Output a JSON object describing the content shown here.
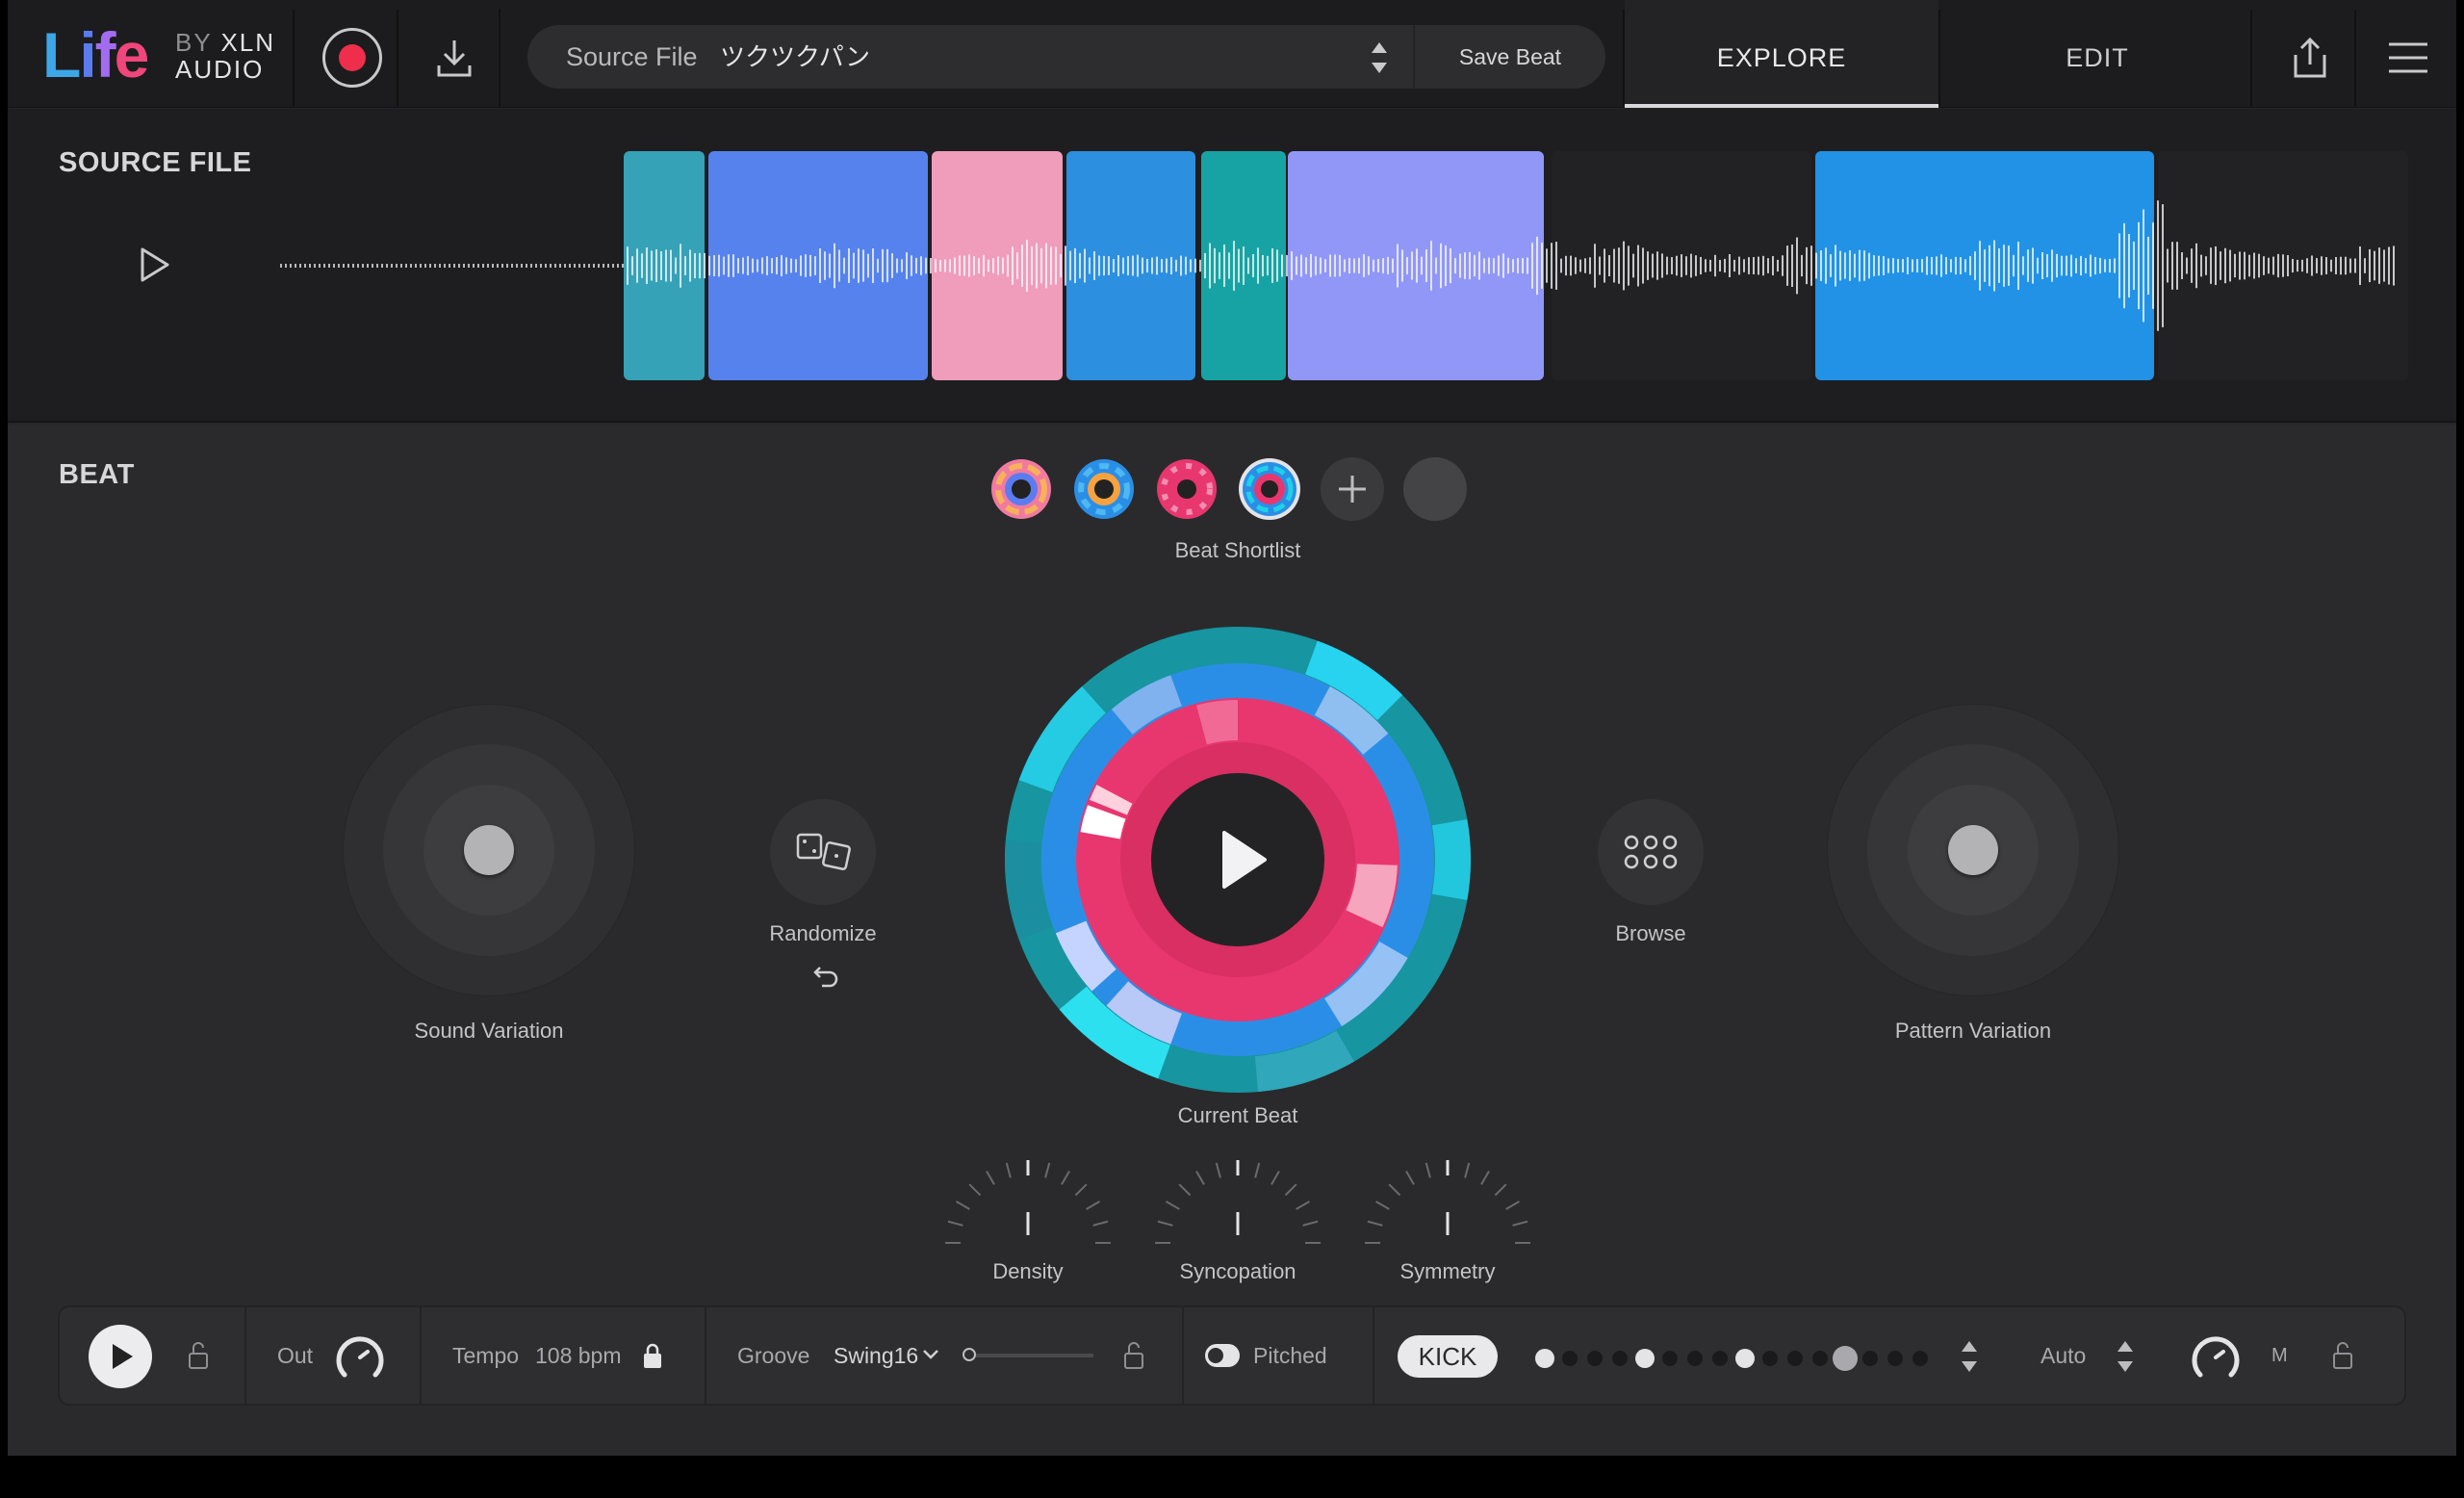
{
  "app": {
    "brand": {
      "life": [
        "L",
        "i",
        "f",
        "e"
      ],
      "by": "BY",
      "xln": "XLN",
      "audio": "AUDIO"
    }
  },
  "topbar": {
    "source_label": "Source File",
    "source_name": "ツクツクパン",
    "save_beat": "Save Beat",
    "tabs": [
      {
        "label": "EXPLORE",
        "active": true
      },
      {
        "label": "EDIT",
        "active": false
      }
    ]
  },
  "source_section": {
    "title": "SOURCE FILE",
    "segment_colors": [
      "#35a2b8",
      "#5682ee",
      "#f09cbb",
      "#2c8fe0",
      "#17a3a3",
      "#9197f7",
      "#222224",
      "#2192e6",
      "#222224"
    ]
  },
  "beat": {
    "title": "BEAT",
    "shortlist_label": "Beat Shortlist",
    "current_beat_label": "Current Beat",
    "sound_variation_label": "Sound Variation",
    "pattern_variation_label": "Pattern Variation",
    "randomize_label": "Randomize",
    "browse_label": "Browse",
    "dials": [
      {
        "label": "Density"
      },
      {
        "label": "Syncopation"
      },
      {
        "label": "Symmetry"
      }
    ]
  },
  "bottombar": {
    "out_label": "Out",
    "tempo_label": "Tempo",
    "tempo_value": "108 bpm",
    "groove_label": "Groove",
    "groove_value": "Swing16",
    "groove_amount": 0.0,
    "pitched_label": "Pitched",
    "pitched_on": true,
    "kick_label": "KICK",
    "auto_label": "Auto",
    "m_label": "M",
    "steps": [
      "on",
      "off",
      "off",
      "off",
      "on",
      "off",
      "off",
      "off",
      "on",
      "off",
      "off",
      "off",
      "big",
      "off",
      "off",
      "off"
    ]
  },
  "colors": {
    "accent_red": "#ee2e4b",
    "pink": "#e8366f",
    "blue": "#2b8ee6",
    "cyan": "#1fd0e6",
    "teal": "#1795a0"
  }
}
